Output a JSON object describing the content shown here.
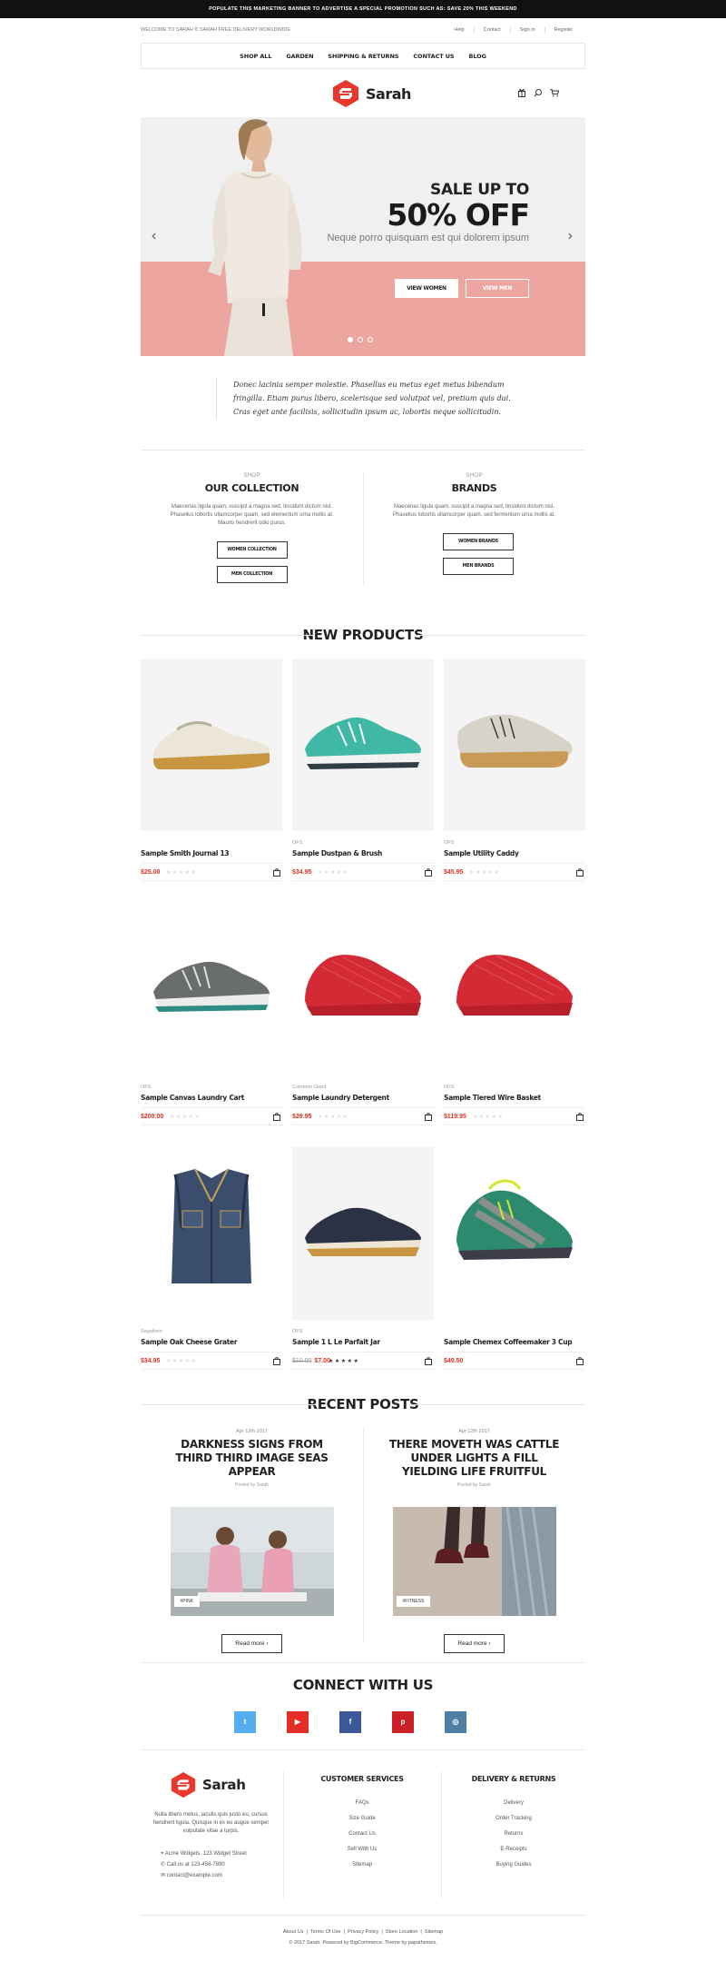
{
  "topbar": {
    "text": "POPULATE THIS MARKETING BANNER TO ADVERTISE A SPECIAL PROMOTION SUCH AS: SAVE 20% THIS WEEKEND"
  },
  "utility": {
    "welcome": "WELCOME TO SARAH ® SARAH FREE DELIVERY WORLDWIDE",
    "links": [
      "Help",
      "Contact",
      "Sign in",
      "Register"
    ]
  },
  "nav": {
    "items": [
      "SHOP ALL",
      "GARDEN",
      "SHIPPING & RETURNS",
      "CONTACT US",
      "BLOG"
    ]
  },
  "brand": {
    "name": "Sarah",
    "accent": "#e8382c"
  },
  "header_icons": [
    "gift-icon",
    "search-icon",
    "cart-icon"
  ],
  "hero": {
    "line1": "SALE UP TO",
    "line2": "50% OFF",
    "subtitle": "Neque porro quisquam est qui dolorem ipsum",
    "button_women": "VIEW WOMEN",
    "button_men": "VIEW MEN",
    "slide_count": 3,
    "active_slide": 1
  },
  "quote": {
    "text": "Donec lacinia semper molestie. Phasellus eu metus eget metus bibendum fringilla. Etiam purus libero, scelerisque sed volutpat vel, pretium quis dui. Cras eget ante facilisis, sollicitudin ipsum ac, lobortis neque sollicitudin."
  },
  "collections": [
    {
      "small": "SHOP",
      "title": "OUR COLLECTION",
      "desc": "Maecenas ligula quam, suscipit a magna sed, tincidunt dictum nisl. Phasellus lobortis ullamcorper quam, sed elementum urna mollis at. Mauris hendrerit odio purus.",
      "buttons": [
        "WOMEN COLLECTION",
        "MEN COLLECTION"
      ]
    },
    {
      "small": "SHOP",
      "title": "BRANDS",
      "desc": "Maecenas ligula quam, suscipit a magna sed, tincidunt dictum nisl. Phasellus lobortis ullamcorper quam, sed fermentum urna mollis at.",
      "buttons": [
        "WOMEN BRANDS",
        "MEN BRANDS"
      ]
    }
  ],
  "new_products": {
    "title": "NEW PRODUCTS",
    "items": [
      {
        "brand": "",
        "name": "Sample Smith Journal 13",
        "price": "$25.00",
        "old_price": ""
      },
      {
        "brand": "OFS",
        "name": "Sample Dustpan & Brush",
        "price": "$34.95",
        "old_price": ""
      },
      {
        "brand": "OFS",
        "name": "Sample Utility Caddy",
        "price": "$45.95",
        "old_price": ""
      },
      {
        "brand": "OFS",
        "name": "Sample Canvas Laundry Cart",
        "price": "$200.00",
        "old_price": ""
      },
      {
        "brand": "Common Good",
        "name": "Sample Laundry Detergent",
        "price": "$29.95",
        "old_price": ""
      },
      {
        "brand": "OFS",
        "name": "Sample Tiered Wire Basket",
        "price": "$119.95",
        "old_price": ""
      },
      {
        "brand": "Sagaform",
        "name": "Sample Oak Cheese Grater",
        "price": "$34.95",
        "old_price": ""
      },
      {
        "brand": "OFS",
        "name": "Sample 1 L Le Parfait Jar",
        "price": "$7.00",
        "old_price": "$10.00"
      },
      {
        "brand": "",
        "name": "Sample Chemex Coffeemaker 3 Cup",
        "price": "$49.50",
        "old_price": ""
      }
    ]
  },
  "recent_posts": {
    "title": "RECENT POSTS",
    "posts": [
      {
        "date": "Apr 12th 2017",
        "title": "DARKNESS SIGNS FROM THIRD THIRD IMAGE SEAS APPEAR",
        "by": "Posted by Sarah",
        "tag": "#PINK",
        "more": "Read more"
      },
      {
        "date": "Apr 12th 2017",
        "title": "THERE MOVETH WAS CATTLE UNDER LIGHTS A FILL YIELDING LIFE FRUITFUL",
        "by": "Posted by Sarah",
        "tag": "#FITNESS",
        "more": "Read more"
      }
    ]
  },
  "connect": {
    "title": "CONNECT WITH US",
    "networks": [
      {
        "icon": "twitter-icon",
        "glyph": "t",
        "color": "#55acee"
      },
      {
        "icon": "youtube-icon",
        "glyph": "▶",
        "color": "#e52d27"
      },
      {
        "icon": "facebook-icon",
        "glyph": "f",
        "color": "#3b5998"
      },
      {
        "icon": "pinterest-icon",
        "glyph": "p",
        "color": "#cb2027"
      },
      {
        "icon": "instagram-icon",
        "glyph": "◎",
        "color": "#517fa4"
      }
    ]
  },
  "footer": {
    "about": "Nulla libero metus, iaculis quis justo eu, cursus hendrerit ligula. Quisque in ex eu augue semper vulputate vitae a turpis.",
    "address": "Acme Widgets, 123 Widget Street",
    "phone": "Call us at 123-456-7890",
    "email": "contact@example.com",
    "customer_services": {
      "title": "CUSTOMER SERVICES",
      "links": [
        "FAQs",
        "Size Guide",
        "Contact Us",
        "Sell With Us",
        "Sitemap"
      ]
    },
    "delivery": {
      "title": "DELIVERY & RETURNS",
      "links": [
        "Delivery",
        "Order Tracking",
        "Returns",
        "E-Receipts",
        "Buying Guides"
      ]
    },
    "bottom_links": [
      "About Us",
      "Terms Of Use",
      "Privacy Policy",
      "Store Location",
      "Sitemap"
    ],
    "copyright": "© 2017 Sarah. Powered by BigCommerce. Theme by papathemes."
  }
}
